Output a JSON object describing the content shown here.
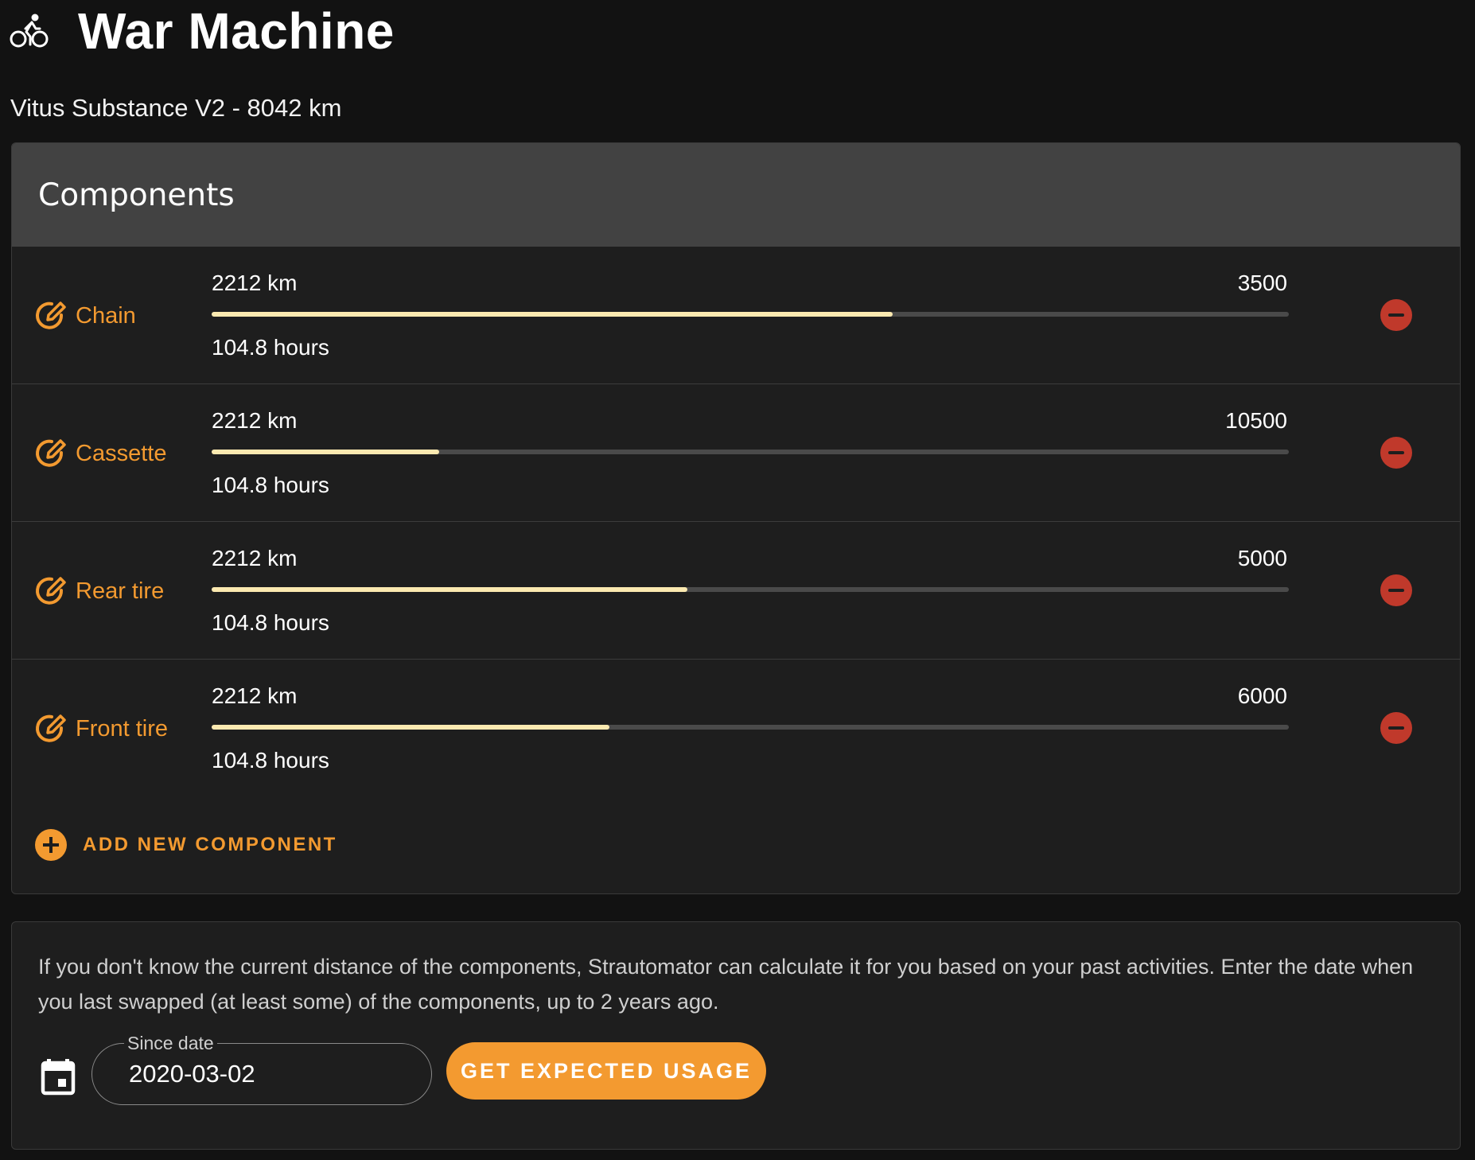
{
  "header": {
    "title": "War Machine",
    "icon": "bike-icon"
  },
  "subtitle": "Vitus Substance V2 - 8042 km",
  "components_card": {
    "title": "Components",
    "items": [
      {
        "name": "Chain",
        "distance": "2212 km",
        "limit": "3500",
        "hours": "104.8 hours",
        "progress": 0.632
      },
      {
        "name": "Cassette",
        "distance": "2212 km",
        "limit": "10500",
        "hours": "104.8 hours",
        "progress": 0.211
      },
      {
        "name": "Rear tire",
        "distance": "2212 km",
        "limit": "5000",
        "hours": "104.8 hours",
        "progress": 0.442
      },
      {
        "name": "Front tire",
        "distance": "2212 km",
        "limit": "6000",
        "hours": "104.8 hours",
        "progress": 0.369
      }
    ],
    "add_label": "ADD NEW COMPONENT"
  },
  "info_card": {
    "text": "If you don't know the current distance of the components, Strautomator can calculate it for you based on your past activities. Enter the date when you last swapped (at least some) of the components, up to 2 years ago.",
    "date_label": "Since date",
    "date_value": "2020-03-02",
    "button_label": "GET EXPECTED USAGE"
  },
  "colors": {
    "accent": "#f39a30",
    "progress": "#fbe9b0",
    "remove": "#c0392b",
    "background": "#121212",
    "card": "#1e1e1e",
    "card_header": "#424242"
  }
}
